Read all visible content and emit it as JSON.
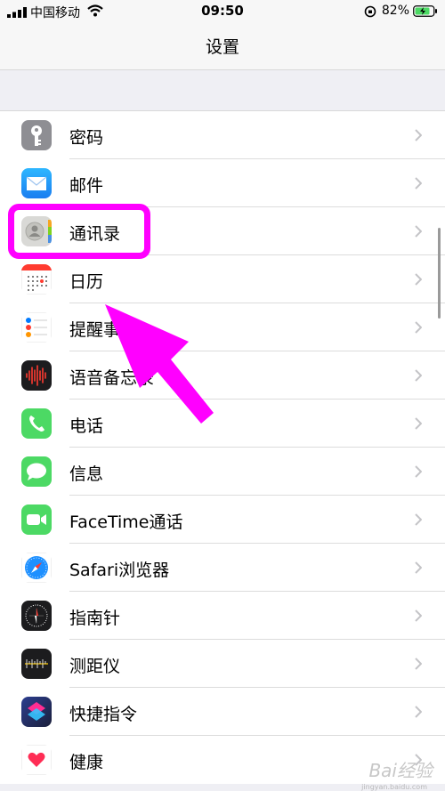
{
  "status_bar": {
    "carrier": "中国移动",
    "time": "09:50",
    "battery": "82%"
  },
  "nav": {
    "title": "设置"
  },
  "items": [
    {
      "label": "密码",
      "icon": "key-icon"
    },
    {
      "label": "邮件",
      "icon": "mail-icon"
    },
    {
      "label": "通讯录",
      "icon": "contacts-icon"
    },
    {
      "label": "日历",
      "icon": "calendar-icon"
    },
    {
      "label": "提醒事项",
      "icon": "reminders-icon"
    },
    {
      "label": "语音备忘录",
      "icon": "voice-memos-icon"
    },
    {
      "label": "电话",
      "icon": "phone-icon"
    },
    {
      "label": "信息",
      "icon": "messages-icon"
    },
    {
      "label": "FaceTime通话",
      "icon": "facetime-icon"
    },
    {
      "label": "Safari浏览器",
      "icon": "safari-icon"
    },
    {
      "label": "指南针",
      "icon": "compass-icon"
    },
    {
      "label": "测距仪",
      "icon": "measure-icon"
    },
    {
      "label": "快捷指令",
      "icon": "shortcuts-icon"
    },
    {
      "label": "健康",
      "icon": "health-icon"
    }
  ],
  "annotation": {
    "highlight_color": "#ff00ff"
  },
  "watermark": {
    "brand": "Bai经验",
    "url": "jingyan.baidu.com"
  }
}
